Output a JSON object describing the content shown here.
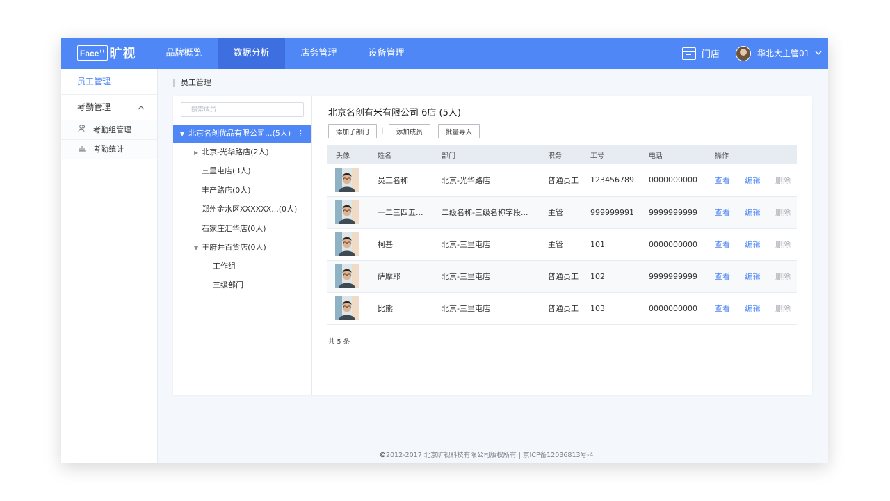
{
  "brand": {
    "face": "Face",
    "sup": "++",
    "name": "旷视"
  },
  "nav": [
    {
      "label": "品牌概览",
      "active": false
    },
    {
      "label": "数据分析",
      "active": true
    },
    {
      "label": "店务管理",
      "active": false
    },
    {
      "label": "设备管理",
      "active": false
    }
  ],
  "header": {
    "store_label": "门店",
    "user_name": "华北大主管01",
    "chevron": "chevron-down-icon"
  },
  "sidebar": {
    "employee": "员工管理",
    "attendance": "考勤管理",
    "sub_items": [
      {
        "label": "考勤组管理",
        "icon": "users-icon"
      },
      {
        "label": "考勤统计",
        "icon": "bar-chart-icon"
      }
    ]
  },
  "breadcrumb": "员工管理",
  "tree": {
    "search_placeholder": "搜索成员",
    "root": "北京名创优品有限公司...(5人)",
    "nodes": [
      "北京-光华路店(2人)",
      "三里屯店(3人)",
      "丰产路店(0人)",
      "郑州金水区XXXXXX...(0人)",
      "石家庄汇华店(0人)",
      "王府井百货店(0人)",
      "工作组",
      "三级部门"
    ]
  },
  "main": {
    "title": "北京名创有米有限公司 6店 (5人)",
    "buttons": {
      "add_sub": "添加子部门",
      "add_member": "添加成员",
      "bulk_import": "批量导入"
    },
    "columns": [
      "头像",
      "姓名",
      "部门",
      "职务",
      "工号",
      "电话",
      "操作"
    ],
    "rows": [
      {
        "name": "员工名称",
        "dept": "北京-光华路店",
        "role": "普通员工",
        "id": "123456789",
        "phone": "0000000000"
      },
      {
        "name": "一二三四五...",
        "dept": "二级名称-三级名称字段...",
        "role": "主管",
        "id": "999999991",
        "phone": "9999999999"
      },
      {
        "name": "柯基",
        "dept": "北京-三里屯店",
        "role": "主管",
        "id": "101",
        "phone": "0000000000"
      },
      {
        "name": "萨摩耶",
        "dept": "北京-三里屯店",
        "role": "普通员工",
        "id": "102",
        "phone": "9999999999"
      },
      {
        "name": "比熊",
        "dept": "北京-三里屯店",
        "role": "普通员工",
        "id": "103",
        "phone": "0000000000"
      }
    ],
    "actions": {
      "view": "查看",
      "edit": "编辑",
      "delete": "删除"
    },
    "total": "共 5 条"
  },
  "footer": {
    "symbol": "©",
    "text": "2012-2017 北京旷视科技有限公司版权所有 | 京ICP备12036813号-4"
  },
  "colors": {
    "accent": "#4f87f6",
    "nav_active": "#3d6fe0"
  }
}
